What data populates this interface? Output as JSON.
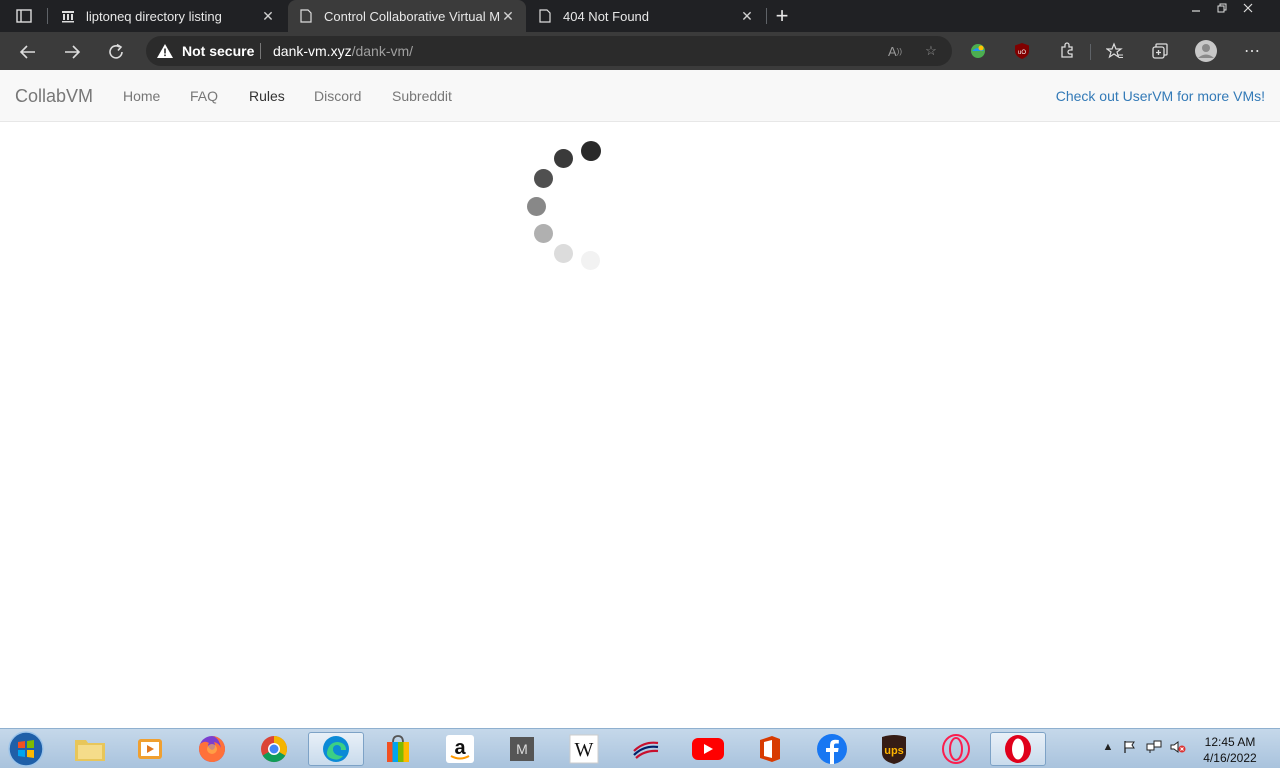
{
  "browser": {
    "tabs": [
      {
        "title": "liptoneq directory listing",
        "favicon": "building-icon",
        "active": false
      },
      {
        "title": "Control Collaborative Virtual Ma",
        "favicon": "page-icon",
        "active": true
      },
      {
        "title": "404 Not Found",
        "favicon": "page-icon",
        "active": false
      }
    ],
    "security_label": "Not secure",
    "url_host": "dank-vm.xyz",
    "url_path": "/dank-vm/"
  },
  "page": {
    "brand": "CollabVM",
    "nav": [
      "Home",
      "FAQ",
      "Rules",
      "Discord",
      "Subreddit"
    ],
    "active_nav": "Rules",
    "promo": "Check out UserVM for more VMs!"
  },
  "taskbar": {
    "apps": [
      "file-explorer-icon",
      "media-player-icon",
      "firefox-icon",
      "chrome-icon",
      "edge-icon",
      "store-icon",
      "amazon-icon",
      "m-app-icon",
      "wikipedia-icon",
      "bank-icon",
      "youtube-icon",
      "office-icon",
      "facebook-icon",
      "ups-icon",
      "opera-gx-icon",
      "opera-icon"
    ],
    "time": "12:45 AM",
    "date": "4/16/2022"
  },
  "colors": {
    "chrome_dark": "#202124",
    "toolbar": "#3b3b3b",
    "navbar_bg": "#f8f8f8",
    "link_blue": "#337ab7"
  }
}
